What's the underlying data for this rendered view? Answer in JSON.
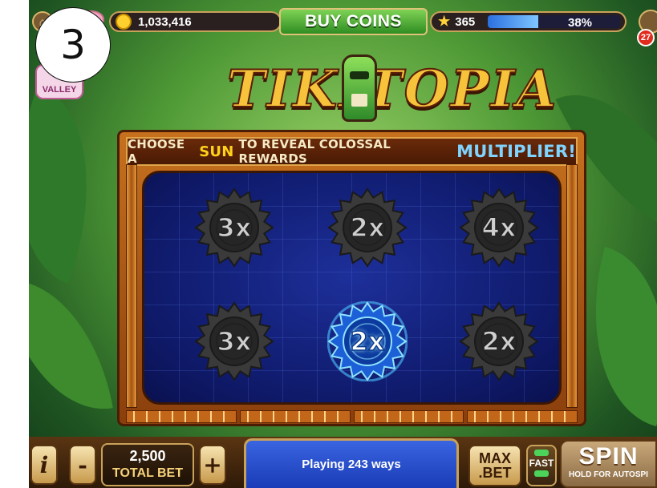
{
  "step_marker": "3",
  "topbar": {
    "coins": "1,033,416",
    "buy_coins_label": "BUY COINS",
    "level": "365",
    "xp_percent_label": "38%",
    "xp_fraction": 0.38,
    "notification_count": "27",
    "valley_badge": "VALLEY"
  },
  "logo": {
    "text": "TIKITOPIA"
  },
  "banner": {
    "part1": "CHOOSE A",
    "sun_word": "SUN",
    "part2": "TO REVEAL COLOSSAL REWARDS",
    "mult_word": "MULTIPLIER!"
  },
  "suns": [
    {
      "label": "3x",
      "selected": false
    },
    {
      "label": "2x",
      "selected": false
    },
    {
      "label": "4x",
      "selected": false
    },
    {
      "label": "3x",
      "selected": false
    },
    {
      "label": "2x",
      "selected": true
    },
    {
      "label": "2x",
      "selected": false
    }
  ],
  "bottombar": {
    "info_label": "i",
    "minus_label": "-",
    "plus_label": "+",
    "total_bet_amount": "2,500",
    "total_bet_label": "TOTAL BET",
    "ways_text": "Playing 243 ways",
    "max_label": "MAX",
    "bet_label": ".BET",
    "fast_label": "FAST",
    "spin_label": "SPIN",
    "autospin_hint": "HOLD FOR AUTOSPI"
  },
  "colors": {
    "accent_gold": "#f6c33a",
    "board_blue": "#1d2f9a",
    "selected_glow": "#4fc3ff"
  }
}
